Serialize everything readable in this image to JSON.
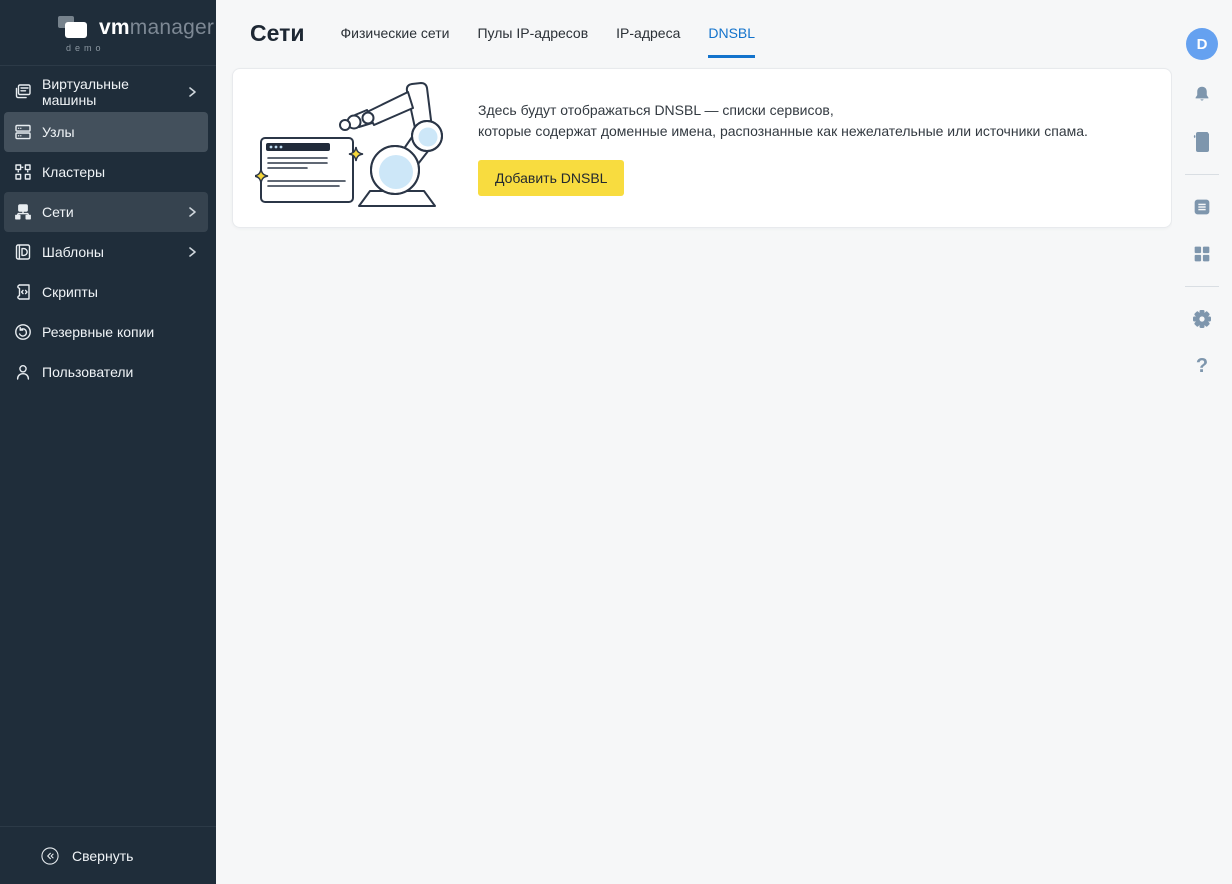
{
  "app": {
    "logo": {
      "primary": "vm",
      "secondary": "manager",
      "subtitle": "demo"
    }
  },
  "sidebar": {
    "items": [
      {
        "label": "Виртуальные машины",
        "icon": "virtual-machines-icon",
        "expandable": true,
        "state": "normal"
      },
      {
        "label": "Узлы",
        "icon": "nodes-icon",
        "expandable": false,
        "state": "highlighted"
      },
      {
        "label": "Кластеры",
        "icon": "clusters-icon",
        "expandable": false,
        "state": "normal"
      },
      {
        "label": "Сети",
        "icon": "networks-icon",
        "expandable": true,
        "state": "selected"
      },
      {
        "label": "Шаблоны",
        "icon": "templates-icon",
        "expandable": true,
        "state": "normal"
      },
      {
        "label": "Скрипты",
        "icon": "scripts-icon",
        "expandable": false,
        "state": "normal"
      },
      {
        "label": "Резервные копии",
        "icon": "backups-icon",
        "expandable": false,
        "state": "normal"
      },
      {
        "label": "Пользователи",
        "icon": "users-icon",
        "expandable": false,
        "state": "normal"
      }
    ],
    "collapse_label": "Свернуть"
  },
  "header": {
    "title": "Сети",
    "tabs": [
      {
        "label": "Физические сети",
        "active": false
      },
      {
        "label": "Пулы IP-адресов",
        "active": false
      },
      {
        "label": "IP-адреса",
        "active": false
      },
      {
        "label": "DNSBL",
        "active": true
      }
    ]
  },
  "empty_state": {
    "line1": "Здесь будут отображаться DNSBL — списки сервисов,",
    "line2": "которые содержат доменные имена, распознанные как нежелательные или источники спама.",
    "button_label": "Добавить DNSBL"
  },
  "right_rail": {
    "avatar_initial": "D",
    "help_label": "?"
  },
  "colors": {
    "sidebar_bg": "#1f2d3a",
    "item_highlight": "#43505c",
    "item_selected": "#36434f",
    "accent_blue": "#1373cc",
    "button_yellow": "#f8dc3f",
    "avatar_blue": "#65a1f0",
    "rail_icon": "#7e96ad",
    "page_bg": "#f6f7f8",
    "card_bg": "#ffffff"
  }
}
